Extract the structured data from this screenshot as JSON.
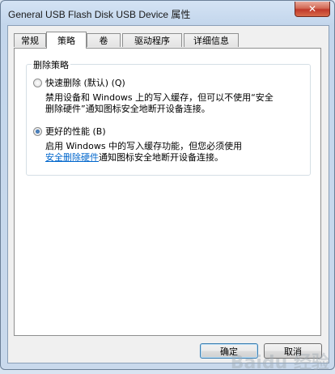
{
  "window": {
    "title": "General USB Flash Disk USB Device 属性",
    "close_symbol": "✕"
  },
  "tabs": [
    {
      "label": "常规",
      "active": false
    },
    {
      "label": "策略",
      "active": true
    },
    {
      "label": "卷",
      "active": false
    },
    {
      "label": "驱动程序",
      "active": false
    },
    {
      "label": "详细信息",
      "active": false
    }
  ],
  "policy": {
    "group_title": "删除策略",
    "option1": {
      "label": "快速删除 (默认) (Q)",
      "checked": false,
      "desc_line1": "禁用设备和 Windows 上的写入缓存，但可以不使用“安全",
      "desc_line2": "删除硬件”通知图标安全地断开设备连接。"
    },
    "option2": {
      "label": "更好的性能 (B)",
      "checked": true,
      "desc_line1": "启用 Windows 中的写入缓存功能，但您必须使用",
      "desc_link": "安全删除硬件",
      "desc_line2_rest": "通知图标安全地断开设备连接。"
    }
  },
  "buttons": {
    "ok": "确定",
    "cancel": "取消"
  },
  "watermark": "Baidu 经验"
}
